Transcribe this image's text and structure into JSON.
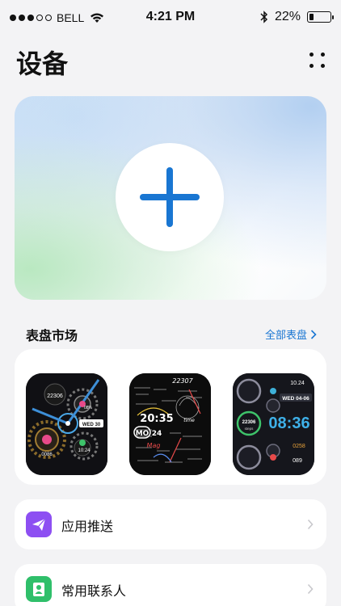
{
  "status_bar": {
    "carrier": "BELL",
    "time": "4:21 PM",
    "battery_percent_text": "22%",
    "battery_level": 0.22,
    "signal_bars": 3
  },
  "header": {
    "title": "设备",
    "more_icon": "more-grid-icon"
  },
  "add_device": {
    "icon": "plus-icon",
    "accent": "#1976d2"
  },
  "watch_market": {
    "title": "表盘市场",
    "see_all_label": "全部表盘",
    "faces": [
      {
        "name": "gear-face",
        "texts": {
          "steps": "22306",
          "percent": "08%",
          "date": "WED 30",
          "distance": "0086",
          "time": "10:24"
        }
      },
      {
        "name": "math-face",
        "texts": {
          "top": "22307",
          "time": "20:35",
          "sub": "time",
          "day": "MO",
          "date": "24",
          "month": "Mag"
        }
      },
      {
        "name": "tech-face",
        "texts": {
          "time_small": "10.24",
          "date": "WED 04-06",
          "steps": "22306",
          "steps_label": "steps",
          "time": "08:36",
          "kcal": "0258",
          "heart": "089"
        }
      }
    ]
  },
  "list": [
    {
      "label": "应用推送",
      "icon": "send-icon",
      "color": "#8d4ff2"
    },
    {
      "label": "常用联系人",
      "icon": "contact-icon",
      "color": "#2fbf6a"
    }
  ]
}
